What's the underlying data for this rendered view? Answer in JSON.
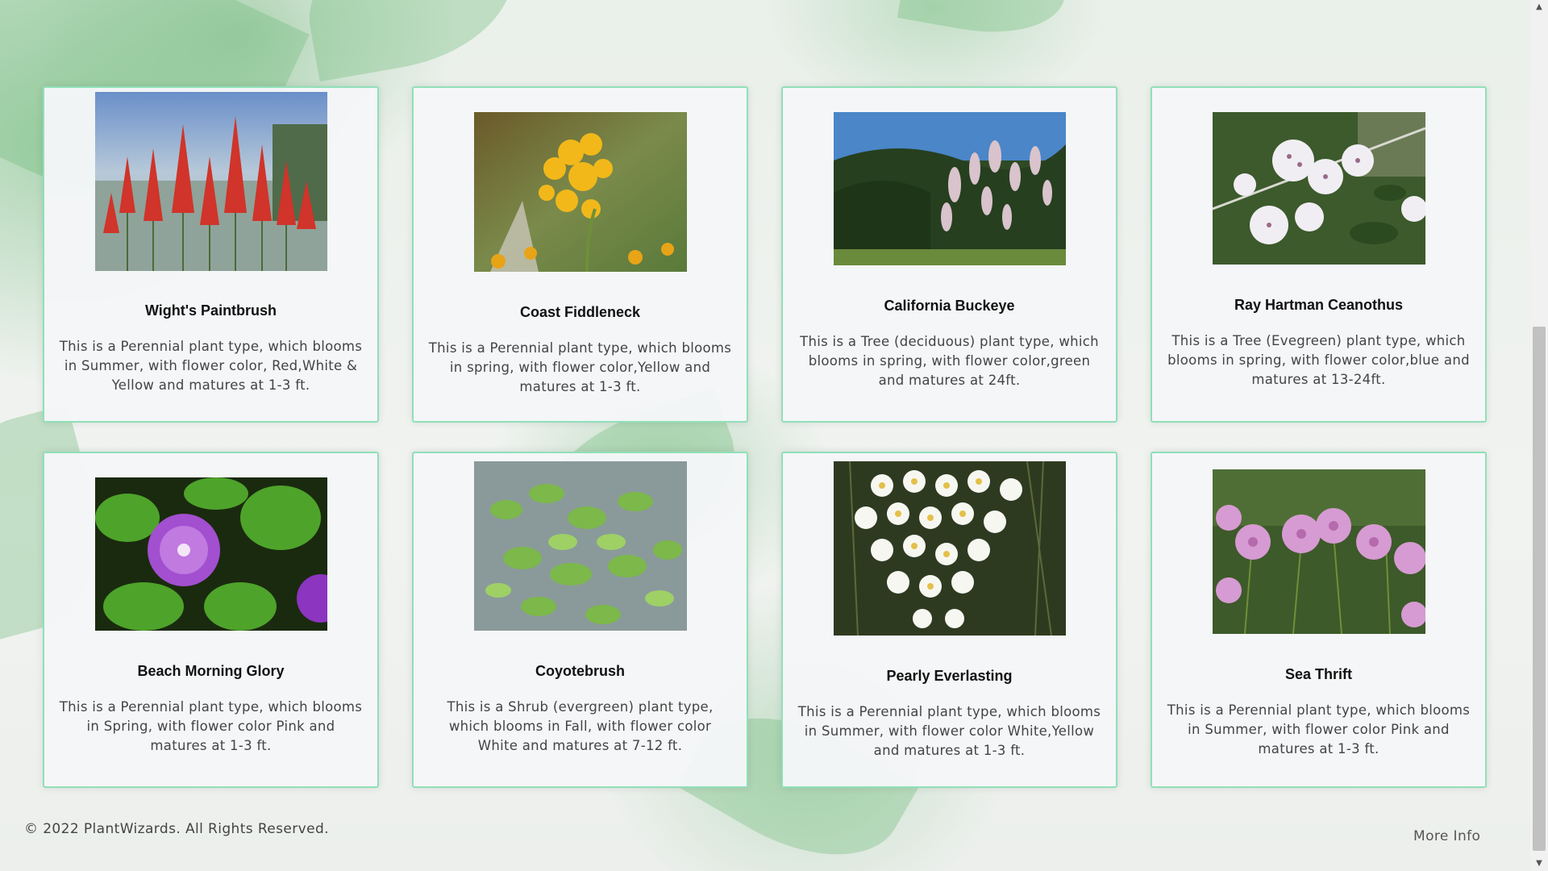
{
  "plants": [
    {
      "name": "Wight's Paintbrush",
      "description": "This is a Perennial plant type, which blooms in Summer, with flower color, Red,White & Yellow and matures at 1-3 ft.",
      "photo_icon": "red-paintbrush-flowers-photo"
    },
    {
      "name": "Coast Fiddleneck",
      "description": "This is a Perennial plant type, which blooms in spring, with flower color,Yellow and matures at 1-3 ft.",
      "photo_icon": "yellow-fiddleneck-flowers-photo"
    },
    {
      "name": "California Buckeye",
      "description": "This is a Tree (deciduous) plant type, which blooms in spring, with flower color,green and matures at 24ft.",
      "photo_icon": "buckeye-tree-photo"
    },
    {
      "name": "Ray Hartman Ceanothus",
      "description": "This is a Tree (Evegreen) plant type, which blooms in spring, with flower color,blue and matures at 13-24ft.",
      "photo_icon": "white-ceanothus-flowers-photo"
    },
    {
      "name": "Beach Morning Glory",
      "description": "This is a Perennial plant type, which blooms in Spring, with flower color Pink and matures at 1-3 ft.",
      "photo_icon": "purple-morning-glory-photo"
    },
    {
      "name": "Coyotebrush",
      "description": "This is a Shrub (evergreen) plant type, which blooms in Fall, with flower color White and matures at 7-12 ft.",
      "photo_icon": "green-coyotebrush-photo"
    },
    {
      "name": "Pearly Everlasting",
      "description": "This is a Perennial plant type, which blooms in Summer, with flower color White,Yellow and matures at 1-3 ft.",
      "photo_icon": "white-everlasting-flowers-photo"
    },
    {
      "name": "Sea Thrift",
      "description": "This is a Perennial plant type, which blooms in Summer, with flower color Pink and matures at 1-3 ft.",
      "photo_icon": "pink-sea-thrift-photo"
    }
  ],
  "footer": {
    "copyright": "© 2022 PlantWizards. All Rights Reserved.",
    "more_info": "More Info"
  },
  "colors": {
    "card_border": "#8fe0b8",
    "card_background": "#f5f6f8",
    "title_text": "#111111",
    "body_text": "#444444"
  }
}
